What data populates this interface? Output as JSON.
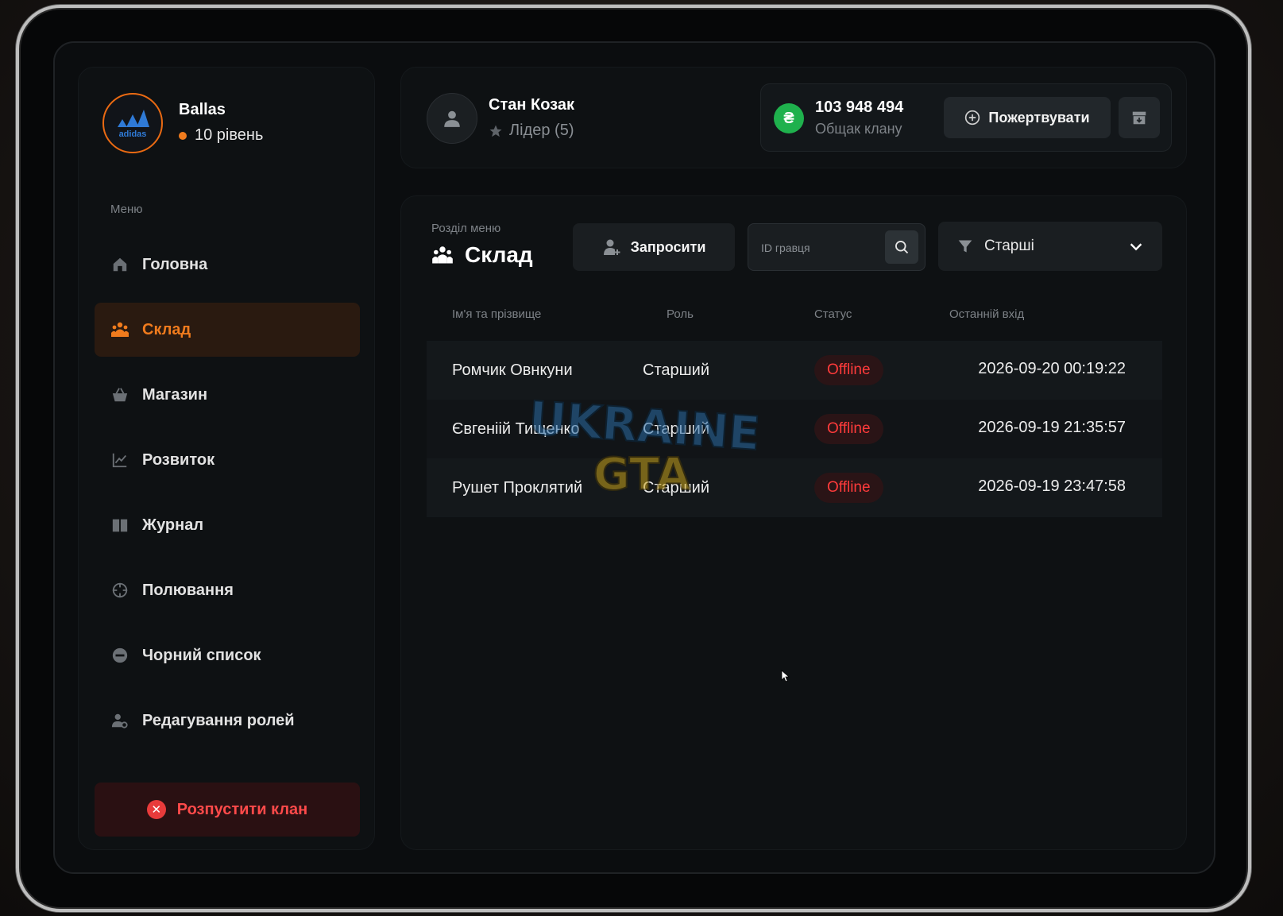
{
  "clan": {
    "name": "Ballas",
    "level": "10 рівень",
    "logo_text": "adidas",
    "accent": "#f07b1d"
  },
  "menu": {
    "caption": "Меню",
    "items": [
      {
        "label": "Головна",
        "icon": "home-icon"
      },
      {
        "label": "Склад",
        "icon": "people-icon",
        "active": true
      },
      {
        "label": "Магазин",
        "icon": "basket-icon"
      },
      {
        "label": "Розвиток",
        "icon": "chart-icon"
      },
      {
        "label": "Журнал",
        "icon": "book-icon"
      },
      {
        "label": "Полювання",
        "icon": "crosshair-icon"
      },
      {
        "label": "Чорний список",
        "icon": "block-icon"
      },
      {
        "label": "Редагування ролей",
        "icon": "user-gear-icon"
      }
    ],
    "disband_label": "Розпустити клан"
  },
  "user": {
    "name": "Стан Козак",
    "role": "Лідер (5)"
  },
  "bank": {
    "currency_symbol": "₴",
    "amount": "103 948 494",
    "label": "Общак клану",
    "donate_label": "Пожертвувати"
  },
  "section": {
    "caption": "Розділ меню",
    "title": "Склад",
    "invite_label": "Запросити",
    "search_placeholder": "ID гравця",
    "filter_value": "Старші"
  },
  "table": {
    "headers": [
      "Ім'я та прізвище",
      "Роль",
      "Статус",
      "Останній вхід"
    ],
    "rows": [
      {
        "name": "Ромчик Овнкуни",
        "role": "Старший",
        "status": "Offline",
        "last_login": "2026-09-20 00:19:22"
      },
      {
        "name": "Євгеніій Тищенко",
        "role": "Старший",
        "status": "Offline",
        "last_login": "2026-09-19 21:35:57"
      },
      {
        "name": "Рушет Проклятий",
        "role": "Старший",
        "status": "Offline",
        "last_login": "2026-09-19 23:47:58"
      }
    ]
  },
  "watermark": {
    "line1": "UKRAINE",
    "line2": "GTA"
  }
}
